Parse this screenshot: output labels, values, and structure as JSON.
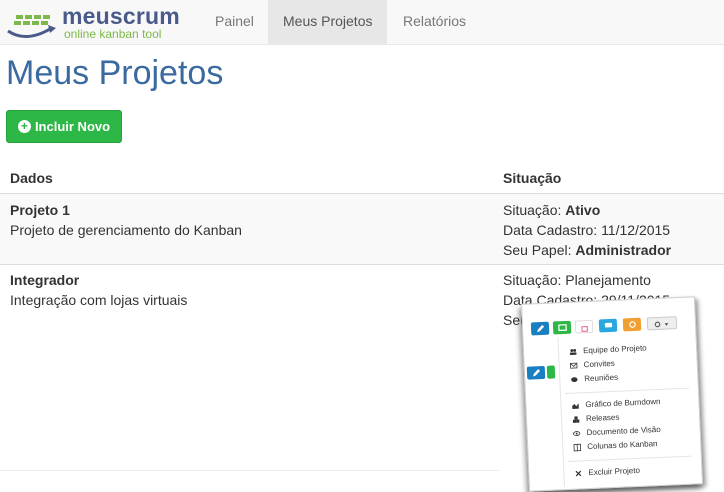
{
  "brand": {
    "name": "meuscrum",
    "tagline": "online kanban tool",
    "color_primary": "#4a5a8a",
    "color_secondary": "#7db94a"
  },
  "nav": {
    "items": [
      {
        "label": "Painel"
      },
      {
        "label": "Meus Projetos",
        "active": true
      },
      {
        "label": "Relatórios"
      }
    ]
  },
  "page": {
    "title": "Meus Projetos",
    "add_button": "Incluir Novo"
  },
  "table": {
    "headers": {
      "dados": "Dados",
      "situacao": "Situação"
    },
    "rows": [
      {
        "name": "Projeto 1",
        "description": "Projeto de gerenciamento do Kanban",
        "situacao_label": "Situação:",
        "situacao_value": "Ativo",
        "data_label": "Data Cadastro:",
        "data_value": "11/12/2015",
        "papel_label": "Seu Papel:",
        "papel_value": "Administrador"
      },
      {
        "name": "Integrador",
        "description": "Integração com lojas virtuais",
        "situacao_label": "Situação:",
        "situacao_value": "Planejamento",
        "data_label": "Data Cadastro:",
        "data_value": "29/11/2015",
        "papel_label": "Seu"
      }
    ]
  },
  "action_menu": {
    "items": [
      {
        "label": "Equipe do Projeto",
        "icon": "users-icon"
      },
      {
        "label": "Convites",
        "icon": "envelope-icon"
      },
      {
        "label": "Reuniões",
        "icon": "comments-icon"
      },
      {
        "label": "Gráfico de Burndown",
        "icon": "area-chart-icon"
      },
      {
        "label": "Releases",
        "icon": "cubes-icon"
      },
      {
        "label": "Documento de Visão",
        "icon": "eye-icon"
      },
      {
        "label": "Colunas do Kanban",
        "icon": "columns-icon"
      },
      {
        "label": "Excluir Projeto",
        "icon": "times-icon"
      }
    ]
  }
}
